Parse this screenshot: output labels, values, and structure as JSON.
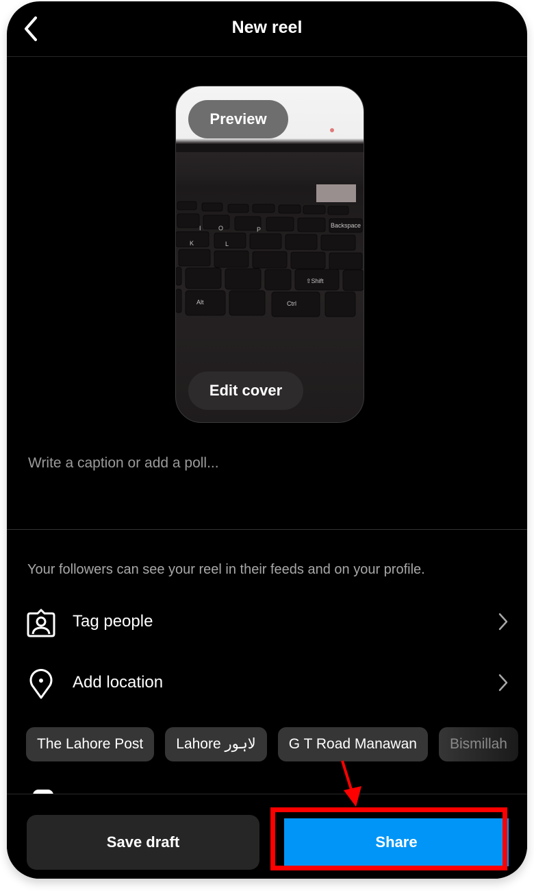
{
  "header": {
    "title": "New reel",
    "back_icon": "chevron-left-icon"
  },
  "preview": {
    "preview_label": "Preview",
    "edit_cover_label": "Edit cover",
    "keyboard_keys": [
      "Backspace",
      "K",
      "L",
      "P",
      "O",
      "Shift",
      "Alt",
      "Ctrl"
    ]
  },
  "caption": {
    "placeholder": "Write a caption or add a poll..."
  },
  "audience_info": "Your followers can see your reel in their feeds and on your profile.",
  "options": [
    {
      "label": "Tag people",
      "icon": "tag-people-icon"
    },
    {
      "label": "Add location",
      "icon": "location-pin-icon"
    }
  ],
  "location_suggestions": [
    "The Lahore Post",
    "Lahore لاہور",
    "G T Road Manawan",
    "Bismillah"
  ],
  "footer": {
    "save_draft_label": "Save draft",
    "share_label": "Share"
  },
  "colors": {
    "share_blue": "#0095f6",
    "annotation_red": "#ff0000",
    "background": "#000000"
  }
}
